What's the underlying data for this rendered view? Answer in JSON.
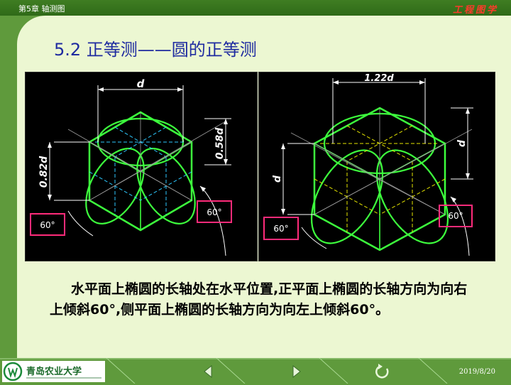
{
  "header": {
    "chapter": "第5章 轴测图",
    "course_title": "工程图学"
  },
  "slide": {
    "title": "5.2  正等测——圆的正等测",
    "caption": "水平面上椭圆的长轴处在水平位置,正平面上椭圆的长轴方向为向右上倾斜60°,侧平面上椭圆的长轴方向为向左上倾斜60°。"
  },
  "figure_left": {
    "top_dim": "d",
    "right_dim": "0.58d",
    "left_dim": "0.82d",
    "angle_left": "60°",
    "angle_right": "60°"
  },
  "figure_right": {
    "top_dim": "1.22d",
    "right_dim": "d",
    "left_dim": "d",
    "angle_left": "60°",
    "angle_right": "60°"
  },
  "footer": {
    "logo_text": "青岛农业大学",
    "date": "2019/8/20",
    "icons": [
      "university-logo-icon",
      "prev-arrow-icon",
      "next-arrow-icon",
      "return-icon"
    ]
  },
  "colors": {
    "background": "#5f9a3c",
    "slide": "#ecf7d2",
    "title": "#1f2ba0",
    "outline": "#3dff3d",
    "axis_cyan": "#2ec9ff",
    "axis_yellow": "#e6e600",
    "highlight_box": "#ff2b7a"
  }
}
